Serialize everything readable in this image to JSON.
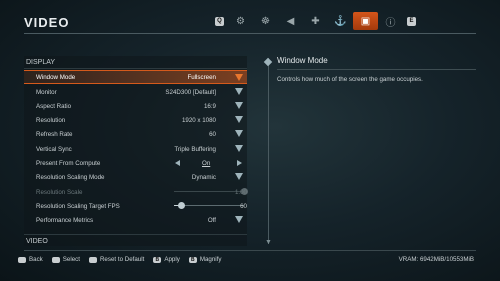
{
  "header": {
    "title": "VIDEO",
    "prev_key": "Q",
    "next_key": "E",
    "tabs": [
      {
        "icon": "gears-icon",
        "glyph": "⚙",
        "active": false
      },
      {
        "icon": "character-icon",
        "glyph": "☸",
        "active": false
      },
      {
        "icon": "audio-icon",
        "glyph": "◀",
        "active": false
      },
      {
        "icon": "controls-icon",
        "glyph": "✚",
        "active": false
      },
      {
        "icon": "accessibility-icon",
        "glyph": "⚓",
        "active": false
      },
      {
        "icon": "monitor-icon",
        "glyph": "▣",
        "active": true
      },
      {
        "icon": "info-icon",
        "glyph": "ⓘ",
        "active": false
      }
    ]
  },
  "settings": {
    "section_display": "DISPLAY",
    "section_video": "VIDEO",
    "rows": [
      {
        "label": "Window Mode",
        "value": "Fullscreen"
      },
      {
        "label": "Monitor",
        "value": "S24D300 [Default]"
      },
      {
        "label": "Aspect Ratio",
        "value": "16:9"
      },
      {
        "label": "Resolution",
        "value": "1920 x 1080"
      },
      {
        "label": "Refresh Rate",
        "value": "60"
      },
      {
        "label": "Vertical Sync",
        "value": "Triple Buffering"
      },
      {
        "label": "Present From Compute",
        "value": "On"
      },
      {
        "label": "Resolution Scaling Mode",
        "value": "Dynamic"
      },
      {
        "label": "Resolution Scale",
        "value": "1.00"
      },
      {
        "label": "Resolution Scaling Target FPS",
        "value": "60"
      },
      {
        "label": "Performance Metrics",
        "value": "Off"
      }
    ],
    "resolution_scale_level": 1.0,
    "target_fps_level": 0.1
  },
  "description": {
    "title": "Window Mode",
    "text": "Controls how much of the screen the game occupies."
  },
  "footer": {
    "hints": [
      {
        "key": "",
        "label": "Back"
      },
      {
        "key": "",
        "label": "Select"
      },
      {
        "key": "",
        "label": "Reset to Default"
      },
      {
        "key": "B",
        "label": "Apply"
      },
      {
        "key": "B",
        "label": "Magnify"
      }
    ],
    "vram": "VRAM: 6942MiB/10553MiB"
  },
  "colors": {
    "accent": "#d55a1c",
    "background": "#15232a"
  }
}
